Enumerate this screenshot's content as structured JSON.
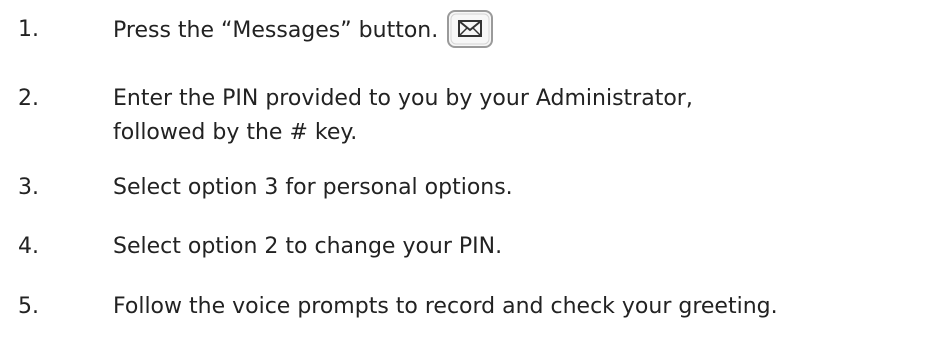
{
  "steps": [
    {
      "number": "1.",
      "text": "Press the “Messages” button.",
      "icon": "envelope-icon"
    },
    {
      "number": "2.",
      "line1": "Enter the PIN provided to you by your Administrator,",
      "line2": "followed by the # key."
    },
    {
      "number": "3.",
      "text": "Select option 3 for personal options."
    },
    {
      "number": "4.",
      "text": "Select option 2 to change your PIN."
    },
    {
      "number": "5.",
      "text": "Follow the voice prompts to record and check your greeting."
    }
  ]
}
